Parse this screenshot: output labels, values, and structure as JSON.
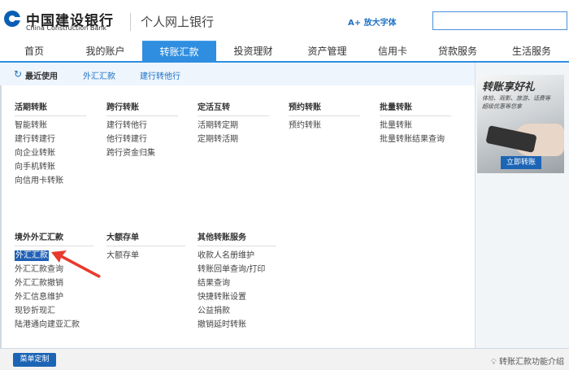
{
  "header": {
    "logo_cn": "中国建设银行",
    "logo_en": "China Construction Bank",
    "title": "个人网上银行",
    "enlarge_font": "A+ 放大字体",
    "search_value": ""
  },
  "nav": {
    "tabs": [
      "首页",
      "我的账户",
      "转账汇款",
      "投资理财",
      "资产管理",
      "信用卡",
      "贷款服务",
      "生活服务"
    ],
    "active": "转账汇款"
  },
  "subbar": {
    "recent": "最近使用",
    "items": [
      "外汇汇款",
      "建行转他行"
    ]
  },
  "sections": [
    {
      "title": "活期转账",
      "items": [
        "智能转账",
        "建行转建行",
        "向企业转账",
        "向手机转账",
        "向信用卡转账"
      ]
    },
    {
      "title": "跨行转账",
      "items": [
        "建行转他行",
        "他行转建行",
        "跨行资金归集"
      ]
    },
    {
      "title": "定活互转",
      "items": [
        "活期转定期",
        "定期转活期"
      ]
    },
    {
      "title": "预约转账",
      "items": [
        "预约转账"
      ]
    },
    {
      "title": "批量转账",
      "items": [
        "批量转账",
        "批量转账结果查询"
      ]
    },
    {
      "title": "境外外汇汇款",
      "items": [
        "外汇汇款",
        "外汇汇款查询",
        "外汇汇款撤销",
        "外汇信息维护",
        "现钞折现汇",
        "陆港通向建亚汇款"
      ]
    },
    {
      "title": "大额存单",
      "items": [
        "大额存单"
      ]
    },
    {
      "title": "其他转账服务",
      "items": [
        "收款人名册维护",
        "转账回单查询/打印",
        "结果查询",
        "快捷转账设置",
        "公益捐款",
        "撤销延时转账"
      ]
    }
  ],
  "ad": {
    "title": "转账享好礼",
    "subtitle_1": "体检、观影、旅游、话费等",
    "subtitle_2": "超级优惠等您拿",
    "button": "立即转账"
  },
  "footer": {
    "menu_button": "菜单定制",
    "intro": "转账汇款功能介绍"
  },
  "colors": {
    "accent": "#2f8ee0",
    "button": "#1c65b5",
    "annotation_arrow": "#e83a2e"
  }
}
